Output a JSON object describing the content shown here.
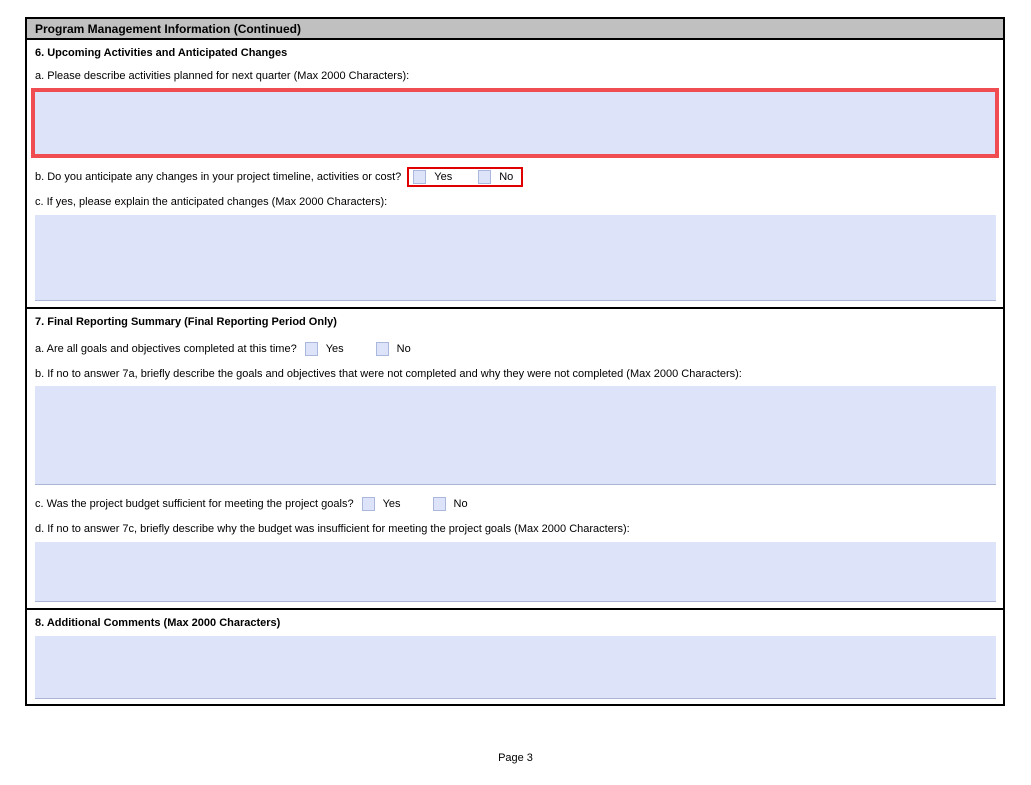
{
  "header": {
    "title": "Program Management Information (Continued)"
  },
  "options": {
    "yes": "Yes",
    "no": "No"
  },
  "section6": {
    "title": "6. Upcoming Activities and Anticipated Changes",
    "label_a": "a. Please describe activities planned for next quarter (Max 2000 Characters):",
    "value_a": "",
    "label_b": "b. Do you anticipate any changes in your project timeline, activities or cost?",
    "label_c": "c. If yes, please explain the anticipated changes (Max 2000 Characters):",
    "value_c": ""
  },
  "section7": {
    "title": "7. Final Reporting Summary (Final Reporting Period Only)",
    "label_a": "a. Are all goals and objectives completed at this time?",
    "label_b": "b. If no to answer 7a, briefly describe the goals and objectives that were not completed and why they were not completed (Max 2000 Characters):",
    "value_b": "",
    "label_c": "c. Was the project budget sufficient for meeting the project goals?",
    "label_d": "d. If no to answer 7c, briefly describe why the budget was insufficient for meeting the project goals (Max 2000 Characters):",
    "value_d": ""
  },
  "section8": {
    "title": "8. Additional Comments (Max 2000 Characters)",
    "value": ""
  },
  "footer": {
    "page_label": "Page 3"
  },
  "colors": {
    "header-fill": "#c0c0c0",
    "field-fill": "#dde4fa",
    "highlight-red-thick": "#f04d52",
    "highlight-red-thin": "#e00000",
    "border-black": "#000000"
  }
}
